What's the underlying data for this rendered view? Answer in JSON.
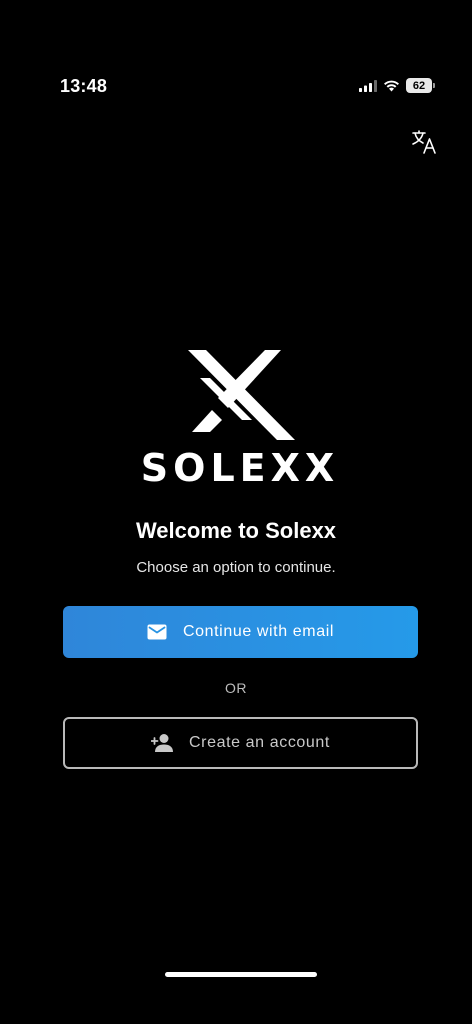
{
  "status_bar": {
    "time": "13:48",
    "battery": "62"
  },
  "header": {
    "translate_icon": "translate-icon"
  },
  "brand": {
    "wordmark": "SOLEXX"
  },
  "welcome": {
    "title": "Welcome to Solexx",
    "subtitle": "Choose an option to continue."
  },
  "actions": {
    "email_label": "Continue with email",
    "email_icon": "mail-icon",
    "or_label": "OR",
    "create_label": "Create an account",
    "create_icon": "add-person-icon"
  },
  "colors": {
    "background": "#000000",
    "primary_button": "#2893e3",
    "outline_button_border": "#b9b9b9"
  }
}
